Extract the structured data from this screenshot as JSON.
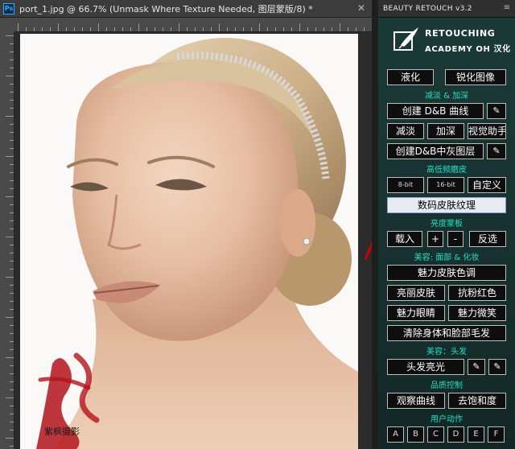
{
  "document": {
    "tab_title": "port_1.jpg @ 66.7% (Unmask Where Texture Needed, 图层蒙版/8) *",
    "ps_badge": "Ps",
    "close_glyph": "✕"
  },
  "photo": {
    "watermark_text": "紫枫摄影"
  },
  "panel": {
    "tab_title": "BEAUTY RETOUCH v3.2",
    "panel_controls": "≡",
    "collapse_glyph": "«",
    "close_glyph": "✕",
    "logo": {
      "line1": "RETOUCHING",
      "line2": "ACADEMY OH 汉化"
    },
    "buttons": {
      "liquify": "液化",
      "sharpen": "锐化图像",
      "create_db_curves": "创建 D&B 曲线",
      "dodge": "减淡",
      "burn": "加深",
      "visual_helper": "视觉助手",
      "create_db_gray_layer": "创建D&B中灰图层",
      "bit8": "8-bit",
      "bit16": "16-bit",
      "custom": "自定义",
      "digital_skin_texture": "数码皮肤纹理",
      "load": "载入",
      "plus": "+",
      "minus": "-",
      "invert": "反选",
      "skin_tone": "魅力皮肤色调",
      "bright_skin": "亮丽皮肤",
      "anti_redness": "抗粉红色",
      "eyes": "魅力眼睛",
      "smile": "魅力微笑",
      "hair_removal": "清除身体和脸部毛发",
      "hair_shine": "头发亮光",
      "observe_curves": "观察曲线",
      "desaturate": "去饱和度",
      "actions": [
        "A",
        "B",
        "C",
        "D",
        "E",
        "F"
      ]
    },
    "sections": {
      "dodge_burn": "减淡 & 加深",
      "frequency": "高低频磨皮",
      "luminosity_masks": "亮度蒙板",
      "face_makeup": "美容: 面部 & 化妆",
      "hair": "美容：头发",
      "quality": "品质控制",
      "user_actions": "用户动作"
    }
  }
}
